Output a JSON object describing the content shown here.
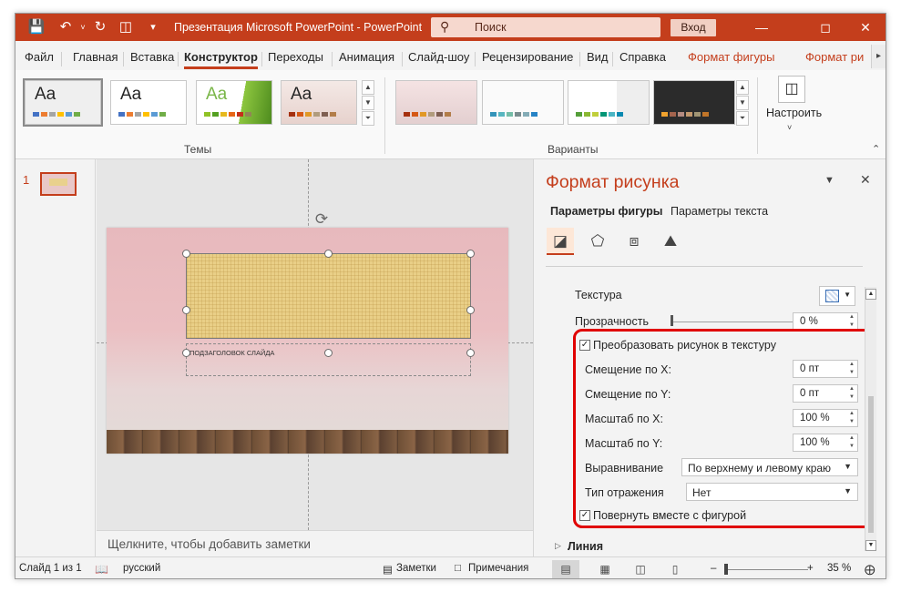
{
  "window": {
    "title": "Презентация Microsoft PowerPoint  -  PowerPoint",
    "search_placeholder": "Поиск",
    "signin_label": "Вход",
    "titlebar_icons": [
      "save-icon",
      "undo-icon",
      "redo-icon",
      "present-icon",
      "customize-qat-icon"
    ],
    "window_controls": [
      "minimize-icon",
      "restore-icon",
      "close-icon"
    ],
    "accent_color": "#c43e1c"
  },
  "ribbon": {
    "tabs": [
      {
        "label": "Файл"
      },
      {
        "label": "Главная"
      },
      {
        "label": "Вставка"
      },
      {
        "label": "Конструктор",
        "active": true
      },
      {
        "label": "Переходы"
      },
      {
        "label": "Анимация"
      },
      {
        "label": "Слайд-шоу"
      },
      {
        "label": "Рецензирование"
      },
      {
        "label": "Вид"
      },
      {
        "label": "Справка"
      },
      {
        "label": "Формат фигуры",
        "context": true
      },
      {
        "label": "Формат ри",
        "context": true
      }
    ],
    "themes": {
      "group_label": "Темы",
      "items": [
        {
          "label": "Aa"
        },
        {
          "label": "Aa"
        },
        {
          "label": "Aa"
        },
        {
          "label": "Aa"
        }
      ]
    },
    "variants": {
      "group_label": "Варианты"
    },
    "customize": {
      "label": "Настроить"
    }
  },
  "thumbnails": {
    "slide_number": "1"
  },
  "slide": {
    "subtitle_placeholder": "ПОДЗАГОЛОВОК СЛАЙДА"
  },
  "notes": {
    "placeholder": "Щелкните, чтобы добавить заметки"
  },
  "format_pane": {
    "title": "Формат рисунка",
    "tabs": [
      {
        "label": "Параметры фигуры",
        "active": true
      },
      {
        "label": "Параметры текста"
      }
    ],
    "icons": [
      "fill-line-icon",
      "effects-icon",
      "size-properties-icon",
      "picture-icon"
    ],
    "texture": {
      "label": "Текстура"
    },
    "transparency": {
      "label": "Прозрачность",
      "value": "0 %"
    },
    "tile": {
      "label": "Преобразовать рисунок в текстуру",
      "checked": true
    },
    "offset_x": {
      "label": "Смещение по X:",
      "value": "0 пт"
    },
    "offset_y": {
      "label": "Смещение по Y:",
      "value": "0 пт"
    },
    "scale_x": {
      "label": "Масштаб по X:",
      "value": "100 %"
    },
    "scale_y": {
      "label": "Масштаб по Y:",
      "value": "100 %"
    },
    "alignment": {
      "label": "Выравнивание",
      "value": "По верхнему и левому краю"
    },
    "mirror": {
      "label": "Тип отражения",
      "value": "Нет"
    },
    "rotate_with_shape": {
      "label": "Повернуть вместе с фигурой",
      "checked": true
    },
    "line_section": {
      "label": "Линия"
    }
  },
  "status_bar": {
    "slide_info": "Слайд 1 из 1",
    "language": "русский",
    "notes_label": "Заметки",
    "comments_label": "Примечания",
    "zoom": "35 %",
    "zoom_percent": 35
  }
}
